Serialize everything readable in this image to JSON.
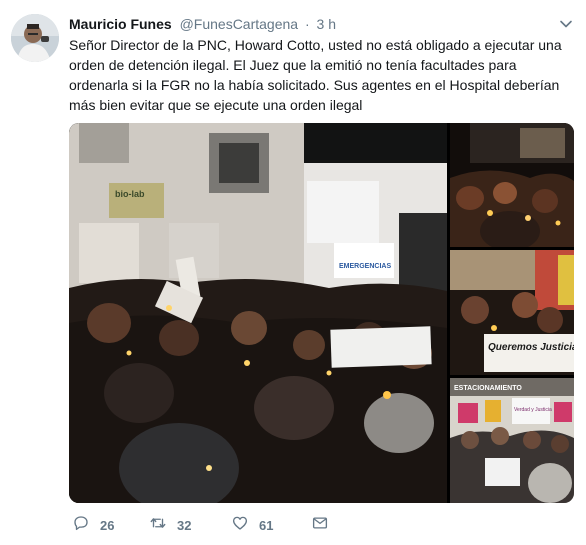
{
  "tweet": {
    "author_name": "Mauricio Funes",
    "author_handle": "@FunesCartagena",
    "separator": "·",
    "timestamp": "3 h",
    "text": "Señor Director de la PNC, Howard Cotto, usted no está obligado a ejecutar una orden de detención ilegal. El Juez que la emitió no tenía facultades para ordenarla si la FGR no la había solicitado. Sus agentes en el Hospital deberían más bien evitar que se ejecute una orden ilegal"
  },
  "media": {
    "main_photo": {
      "signs": [
        "bio-lab",
        "EMERGENCIAS"
      ]
    },
    "photo_2_banner": "Queremos Justicia a los arbitrarios",
    "photo_3_signs": [
      "ESTACIONAMIENTO",
      "Verdad y Justicia"
    ]
  },
  "actions": {
    "replies": "26",
    "retweets": "32",
    "likes": "61"
  },
  "icons": {
    "reply": "reply-icon",
    "retweet": "retweet-icon",
    "like": "heart-icon",
    "dm": "envelope-icon",
    "caret": "chevron-down-icon"
  },
  "colors": {
    "text": "#14171a",
    "secondary": "#657786"
  }
}
